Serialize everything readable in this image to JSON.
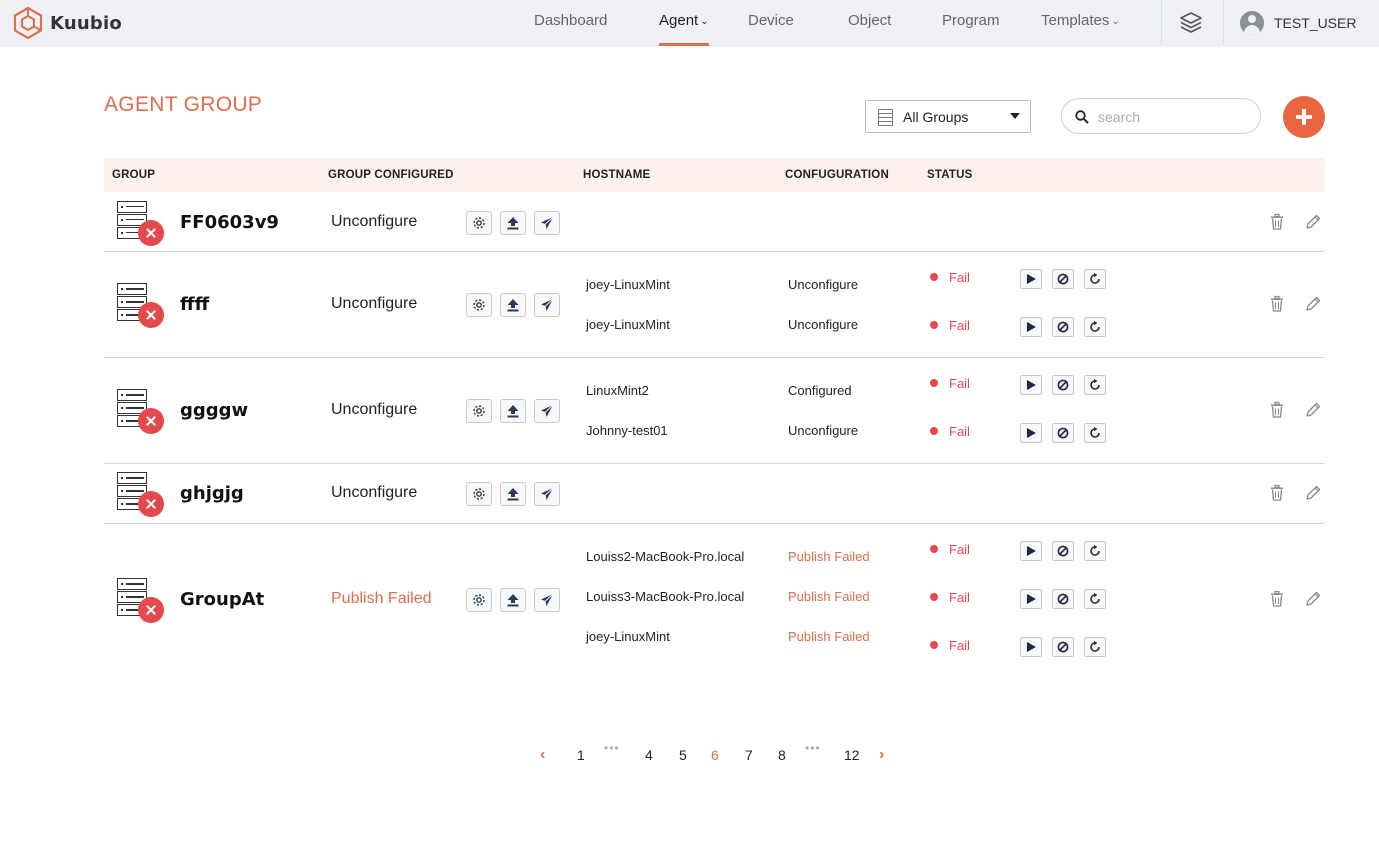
{
  "app": {
    "name": "Kuubio"
  },
  "nav": {
    "items": [
      {
        "label": "Dashboard"
      },
      {
        "label": "Agent"
      },
      {
        "label": "Device"
      },
      {
        "label": "Object"
      },
      {
        "label": "Program"
      },
      {
        "label": "Templates"
      }
    ],
    "active": "Agent"
  },
  "user": {
    "name": "TEST_USER"
  },
  "page": {
    "title": "AGENT GROUP"
  },
  "filter": {
    "selected": "All Groups"
  },
  "search": {
    "placeholder": "search",
    "value": ""
  },
  "table": {
    "headers": {
      "group": "GROUP",
      "group_configured": "GROUP CONFIGURED",
      "hostname": "HOSTNAME",
      "configuration": "CONFUGURATION",
      "status": "STATUS"
    },
    "rows": [
      {
        "name": "FF0603v9",
        "configured": "Unconfigure",
        "hosts": []
      },
      {
        "name": "ffff",
        "configured": "Unconfigure",
        "hosts": [
          {
            "hostname": "joey-LinuxMint",
            "config": "Unconfigure",
            "status": "Fail"
          },
          {
            "hostname": "joey-LinuxMint",
            "config": "Unconfigure",
            "status": "Fail"
          }
        ]
      },
      {
        "name": "ggggw",
        "configured": "Unconfigure",
        "hosts": [
          {
            "hostname": "LinuxMint2",
            "config": "Configured",
            "status": "Fail"
          },
          {
            "hostname": "Johnny-test01",
            "config": "Unconfigure",
            "status": "Fail"
          }
        ]
      },
      {
        "name": "ghjgjg",
        "configured": "Unconfigure",
        "hosts": []
      },
      {
        "name": "GroupAt",
        "configured": "Publish Failed",
        "hosts": [
          {
            "hostname": "Louiss2-MacBook-Pro.local",
            "config": "Publish Failed",
            "status": "Fail"
          },
          {
            "hostname": "Louiss3-MacBook-Pro.local",
            "config": "Publish Failed",
            "status": "Fail"
          },
          {
            "hostname": "joey-LinuxMint",
            "config": "Publish Failed",
            "status": "Fail"
          }
        ]
      }
    ]
  },
  "pagination": {
    "pages": [
      "1",
      "4",
      "5",
      "6",
      "7",
      "8",
      "12"
    ],
    "current": "6",
    "ellipsis": "•••",
    "prev": "‹",
    "next": "›"
  },
  "colors": {
    "accent": "#e06d4b",
    "fail": "#e5484d",
    "header_bg": "#fdf1ee",
    "topbar_bg": "#eef0f4"
  },
  "icons": {
    "row_actions": [
      "gear-icon",
      "upload-icon",
      "send-icon"
    ],
    "host_actions": [
      "play-icon",
      "ban-icon",
      "refresh-icon"
    ],
    "row_tools": [
      "trash-icon",
      "pencil-icon"
    ]
  }
}
